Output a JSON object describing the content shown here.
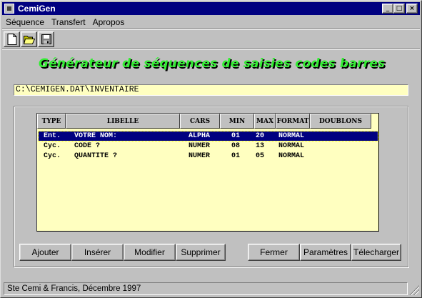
{
  "window": {
    "title": "CemiGen",
    "minimize_glyph": "_",
    "maximize_glyph": "□",
    "close_glyph": "×"
  },
  "menu": [
    {
      "label": "Séquence"
    },
    {
      "label": "Transfert"
    },
    {
      "label": "Apropos"
    }
  ],
  "toolbar": [
    {
      "icon": "new-document-icon"
    },
    {
      "icon": "open-folder-icon"
    },
    {
      "icon": "save-disk-icon"
    }
  ],
  "banner": "Générateur de séquences de saisies codes barres",
  "path": "C:\\CEMIGEN.DAT\\INVENTAIRE",
  "grid": {
    "columns": [
      "TYPE",
      "LIBELLE",
      "CARS",
      "MIN",
      "MAX",
      "FORMAT",
      "DOUBLONS"
    ],
    "rows": [
      {
        "type": "Ent.",
        "libelle": "VOTRE NOM:",
        "cars": "ALPHA",
        "min": "01",
        "max": "20",
        "format": "NORMAL",
        "doublons": "",
        "selected": true
      },
      {
        "type": "Cyc.",
        "libelle": "CODE ?",
        "cars": "NUMER",
        "min": "08",
        "max": "13",
        "format": "NORMAL",
        "doublons": "",
        "selected": false
      },
      {
        "type": "Cyc.",
        "libelle": "QUANTITE ?",
        "cars": "NUMER",
        "min": "01",
        "max": "05",
        "format": "NORMAL",
        "doublons": "",
        "selected": false
      }
    ]
  },
  "buttons_left": [
    {
      "label": "Ajouter"
    },
    {
      "label": "Insérer"
    },
    {
      "label": "Modifier"
    },
    {
      "label": "Supprimer"
    }
  ],
  "buttons_right": [
    {
      "label": "Fermer"
    },
    {
      "label": "Paramètres"
    },
    {
      "label": "Télecharger"
    }
  ],
  "status": "Ste Cemi & Francis,  Décembre 1997",
  "colors": {
    "title_bar": "#000080",
    "banner_text": "#33ee33",
    "grid_background": "#ffffc0",
    "selection": "#000080"
  }
}
